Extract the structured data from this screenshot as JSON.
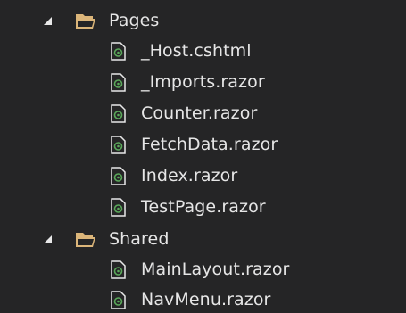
{
  "tree": {
    "folders": [
      {
        "label": "Pages",
        "expanded": true,
        "files": [
          "_Host.cshtml",
          "_Imports.razor",
          "Counter.razor",
          "FetchData.razor",
          "Index.razor",
          "TestPage.razor"
        ]
      },
      {
        "label": "Shared",
        "expanded": true,
        "files": [
          "MainLayout.razor",
          "NavMenu.razor"
        ]
      }
    ]
  },
  "colors": {
    "background": "#252526",
    "text": "#e6e6e6",
    "folder": "#dcb67a",
    "file_accent": "#5aa85a"
  },
  "icons": {
    "expanded_arrow": "triangle-expanded-icon",
    "folder": "folder-open-icon",
    "file": "razor-file-icon"
  }
}
